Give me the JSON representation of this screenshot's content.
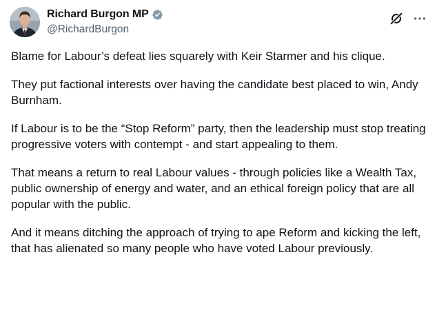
{
  "author": {
    "display_name": "Richard Burgon MP",
    "handle": "@RichardBurgon",
    "verified_color": "#829aab"
  },
  "icons": {
    "avatar": "avatar-photo",
    "verified": "verified-badge-icon",
    "grok": "grok-icon",
    "more": "more-horizontal-icon"
  },
  "post": {
    "paragraphs": [
      "Blame for Labour’s defeat lies squarely with Keir Starmer and his clique.",
      "They put factional interests over having the candidate best placed to win, Andy Burnham.",
      "If Labour is to be the “Stop Reform” party, then the leadership must stop treating progressive voters with contempt - and start appealing to them.",
      "That means a return to real Labour values - through policies like a Wealth Tax, public ownership of energy and water, and an ethical foreign policy that are all popular with the public.",
      "And it means ditching the approach of trying to ape Reform and kicking the left, that has alienated so many people who have voted Labour previously."
    ]
  }
}
